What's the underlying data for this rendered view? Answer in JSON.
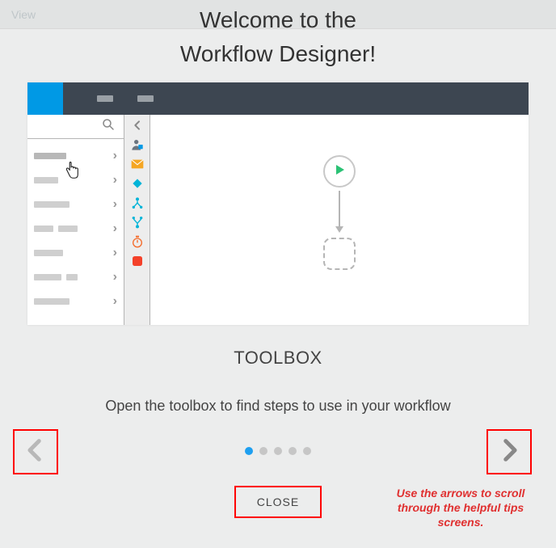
{
  "topbar": {
    "view_label": "View"
  },
  "welcome": {
    "line1": "Welcome to the",
    "line2": "Workflow Designer!"
  },
  "slide": {
    "title": "TOOLBOX",
    "description": "Open the toolbox to find steps to use in your workflow"
  },
  "pager": {
    "total": 5,
    "active_index": 0
  },
  "close_label": "CLOSE",
  "annotation": "Use the arrows to scroll through the helpful tips screens.",
  "icons": {
    "search": "search-icon",
    "collapse": "chevron-left-icon",
    "user": "person-shield-icon",
    "mail": "mail-icon",
    "diamond": "diamond-icon",
    "branch": "branch-icon",
    "merge": "merge-icon",
    "stopwatch": "stopwatch-icon",
    "stop": "stop-icon",
    "play": "play-icon"
  }
}
